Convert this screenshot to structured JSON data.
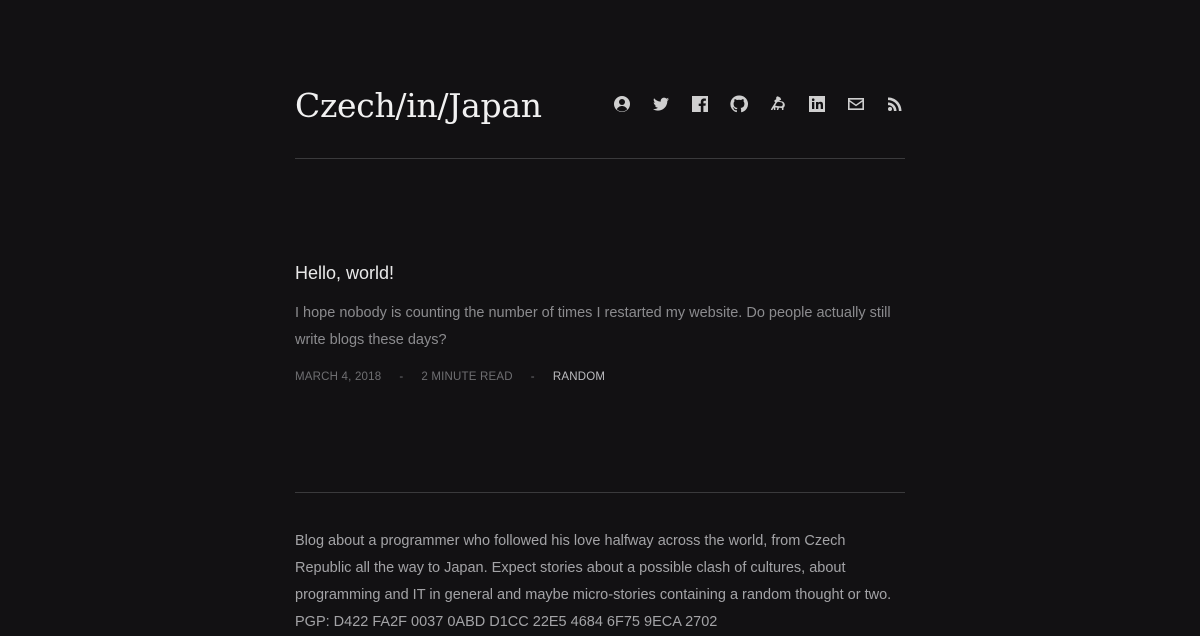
{
  "header": {
    "site_title": "Czech/in/Japan",
    "social_icons": [
      {
        "name": "about-icon"
      },
      {
        "name": "twitter-icon"
      },
      {
        "name": "facebook-icon"
      },
      {
        "name": "github-icon"
      },
      {
        "name": "goat-icon"
      },
      {
        "name": "linkedin-icon"
      },
      {
        "name": "email-icon"
      },
      {
        "name": "rss-icon"
      }
    ]
  },
  "post": {
    "title": "Hello, world!",
    "excerpt": "I hope nobody is counting the number of times I restarted my website. Do people actually still write blogs these days?",
    "date": "MARCH 4, 2018",
    "separator": "-",
    "read_time": "2 MINUTE READ",
    "category": "RANDOM"
  },
  "about": {
    "text": "Blog about a programmer who followed his love halfway across the world, from Czech Republic all the way to Japan. Expect stories about a possible clash of cultures, about programming and IT in general and maybe micro-stories containing a random thought or two.",
    "pgp": "PGP: D422 FA2F 0037 0ABD D1CC 22E5 4684 6F75 9ECA 2702"
  },
  "colors": {
    "background": "#121113",
    "title": "#f1f1f1",
    "muted": "#8b8b8e",
    "rule": "#3a3a3c"
  }
}
